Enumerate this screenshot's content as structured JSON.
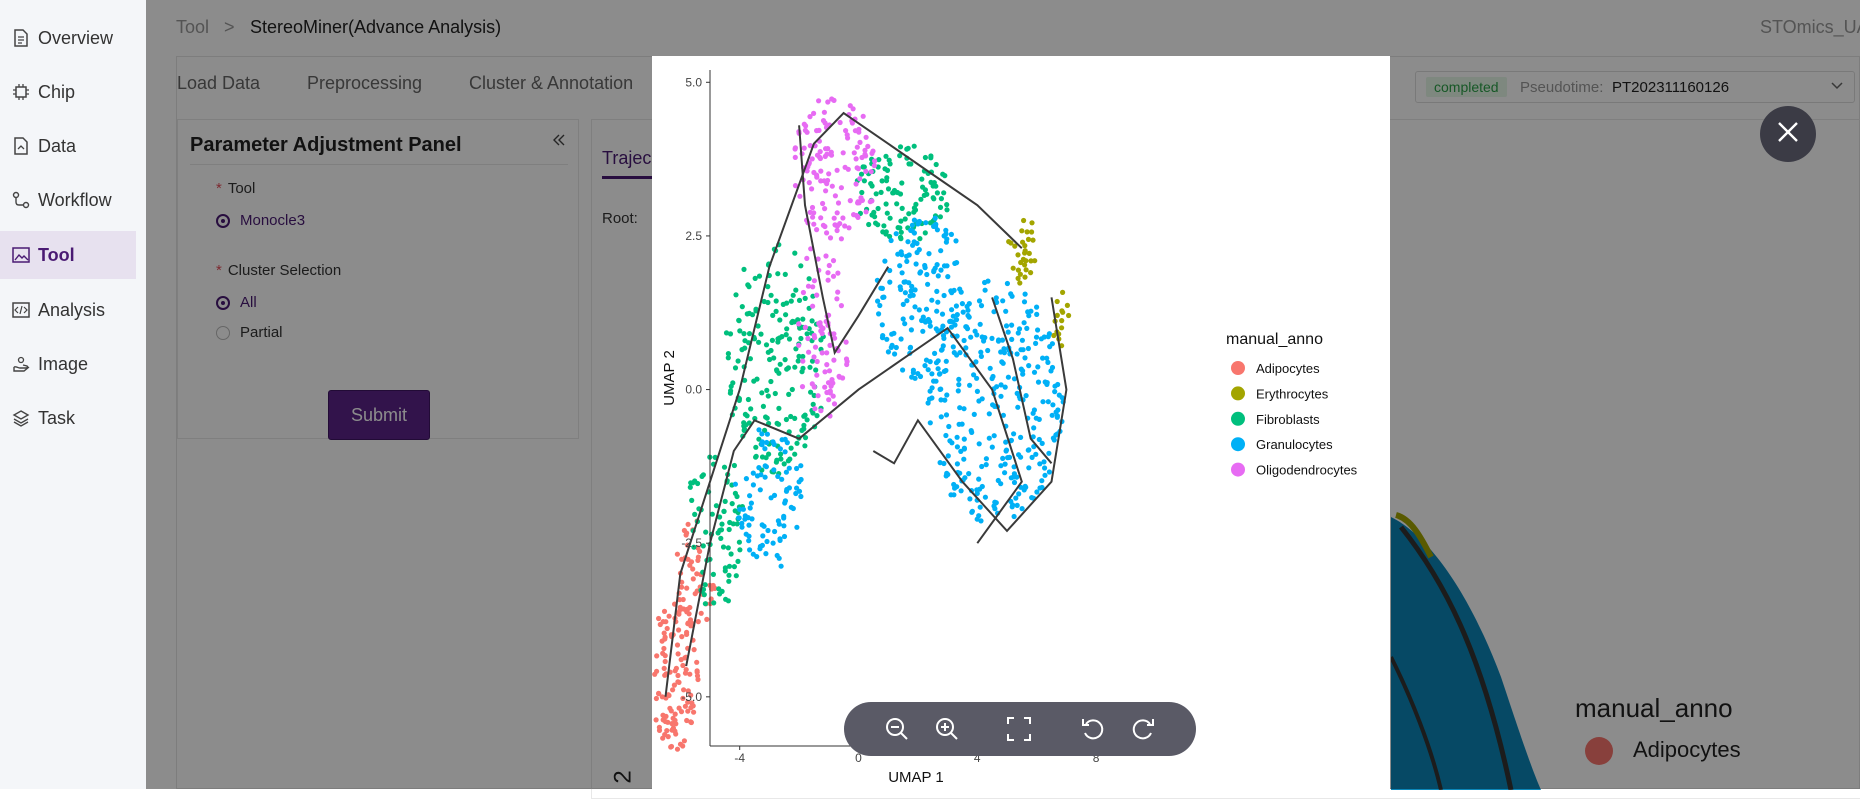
{
  "sidebar": {
    "items": [
      {
        "label": "Overview",
        "icon": "document-icon",
        "active": false
      },
      {
        "label": "Chip",
        "icon": "chip-icon",
        "active": false
      },
      {
        "label": "Data",
        "icon": "file-icon",
        "active": false
      },
      {
        "label": "Workflow",
        "icon": "workflow-icon",
        "active": false
      },
      {
        "label": "Tool",
        "icon": "image-icon",
        "active": true
      },
      {
        "label": "Analysis",
        "icon": "code-icon",
        "active": false
      },
      {
        "label": "Image",
        "icon": "hand-icon",
        "active": false
      },
      {
        "label": "Task",
        "icon": "layers-icon",
        "active": false
      }
    ]
  },
  "breadcrumb": {
    "root": "Tool",
    "separator": ">",
    "current": "StereoMiner(Advance Analysis)"
  },
  "header": {
    "user": "STOmics_UA"
  },
  "tabs": [
    "Load Data",
    "Preprocessing",
    "Cluster & Annotation"
  ],
  "status": {
    "badge": "completed",
    "label": "Pseudotime:",
    "value": "PT202311160126"
  },
  "panel": {
    "title": "Parameter Adjustment Panel",
    "tool_label": "Tool",
    "tool_option": "Monocle3",
    "cluster_label": "Cluster Selection",
    "cluster_options": [
      "All",
      "Partial"
    ],
    "submit": "Submit"
  },
  "right_panel": {
    "tab": "Trajec",
    "root_label": "Root:"
  },
  "background_legend": {
    "title": "manual_anno",
    "first": "Adipocytes"
  },
  "background_axis_fragment": "2",
  "colors": {
    "accent": "#4a1a73",
    "Adipocytes": "#f8766d",
    "Erythrocytes": "#a3a500",
    "Fibroblasts": "#00bf7d",
    "Granulocytes": "#00b0f6",
    "Oligodendrocytes": "#e76bf3"
  },
  "chart_data": {
    "type": "scatter",
    "title": "",
    "xlabel": "UMAP 1",
    "ylabel": "UMAP 2",
    "xlim": [
      -5,
      8.2
    ],
    "ylim": [
      -5.8,
      5.2
    ],
    "xticks": [
      "-4",
      "0",
      "4",
      "8"
    ],
    "yticks": [
      "5.0",
      "2.5",
      "0.0",
      "-2.5",
      "-5.0"
    ],
    "legend_title": "manual_anno",
    "legend_position": "right",
    "series": [
      {
        "name": "Adipocytes",
        "color": "#f8766d",
        "clusters": [
          {
            "cx": -6.2,
            "cy": -4.6,
            "rx": 0.8,
            "ry": 1.3,
            "n": 120
          },
          {
            "cx": -5.5,
            "cy": -3.0,
            "rx": 0.7,
            "ry": 0.9,
            "n": 50
          }
        ]
      },
      {
        "name": "Erythrocytes",
        "color": "#a3a500",
        "clusters": [
          {
            "cx": 5.5,
            "cy": 2.3,
            "rx": 0.5,
            "ry": 0.6,
            "n": 30
          },
          {
            "cx": 6.8,
            "cy": 1.2,
            "rx": 0.3,
            "ry": 0.5,
            "n": 15
          }
        ]
      },
      {
        "name": "Fibroblasts",
        "color": "#00bf7d",
        "clusters": [
          {
            "cx": -2.8,
            "cy": 0.5,
            "rx": 1.7,
            "ry": 1.9,
            "n": 200
          },
          {
            "cx": -4.8,
            "cy": -2.2,
            "rx": 1.0,
            "ry": 1.4,
            "n": 80
          },
          {
            "cx": 1.5,
            "cy": 3.2,
            "rx": 1.6,
            "ry": 0.8,
            "n": 110
          }
        ]
      },
      {
        "name": "Granulocytes",
        "color": "#00b0f6",
        "clusters": [
          {
            "cx": 4.6,
            "cy": -0.2,
            "rx": 2.3,
            "ry": 2.0,
            "n": 300
          },
          {
            "cx": 2.2,
            "cy": 1.5,
            "rx": 1.6,
            "ry": 1.4,
            "n": 160
          },
          {
            "cx": -3.0,
            "cy": -1.8,
            "rx": 1.2,
            "ry": 1.2,
            "n": 90
          }
        ]
      },
      {
        "name": "Oligodendrocytes",
        "color": "#e76bf3",
        "clusters": [
          {
            "cx": -0.8,
            "cy": 3.6,
            "rx": 1.4,
            "ry": 1.2,
            "n": 140
          },
          {
            "cx": -1.2,
            "cy": 1.0,
            "rx": 0.9,
            "ry": 1.5,
            "n": 80
          }
        ]
      }
    ]
  },
  "viewer_toolbar": [
    "zoom-out-icon",
    "zoom-in-icon",
    "fullscreen-icon",
    "rotate-left-icon",
    "rotate-right-icon"
  ]
}
